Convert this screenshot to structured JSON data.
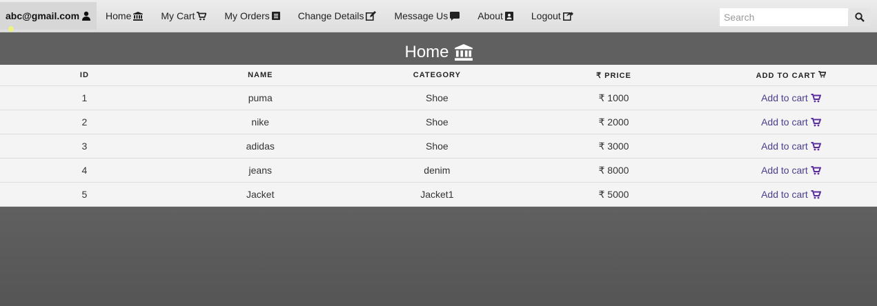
{
  "nav": {
    "user_email": "abc@gmail.com",
    "items": [
      {
        "label": "Home",
        "icon": "bank-icon"
      },
      {
        "label": "My Cart",
        "icon": "cart-icon"
      },
      {
        "label": "My Orders",
        "icon": "orders-icon"
      },
      {
        "label": "Change Details",
        "icon": "edit-icon"
      },
      {
        "label": "Message Us",
        "icon": "message-icon"
      },
      {
        "label": "About",
        "icon": "contact-card-icon"
      },
      {
        "label": "Logout",
        "icon": "logout-icon"
      }
    ],
    "search_placeholder": "Search"
  },
  "page": {
    "title": "Home"
  },
  "table": {
    "headers": [
      "ID",
      "NAME",
      "CATEGORY",
      "PRICE",
      "ADD TO CART"
    ],
    "currency_symbol": "₹",
    "rows": [
      {
        "id": "1",
        "name": "puma",
        "category": "Shoe",
        "price": "1000",
        "action": "Add to cart"
      },
      {
        "id": "2",
        "name": "nike",
        "category": "Shoe",
        "price": "2000",
        "action": "Add to cart"
      },
      {
        "id": "3",
        "name": "adidas",
        "category": "Shoe",
        "price": "3000",
        "action": "Add to cart"
      },
      {
        "id": "4",
        "name": "jeans",
        "category": "denim",
        "price": "8000",
        "action": "Add to cart"
      },
      {
        "id": "5",
        "name": "Jacket",
        "category": "Jacket1",
        "price": "5000",
        "action": "Add to cart"
      }
    ]
  },
  "colors": {
    "link": "#4a3d8b",
    "cart_icon": "#5a2ca0",
    "header_bg": "#606060"
  }
}
